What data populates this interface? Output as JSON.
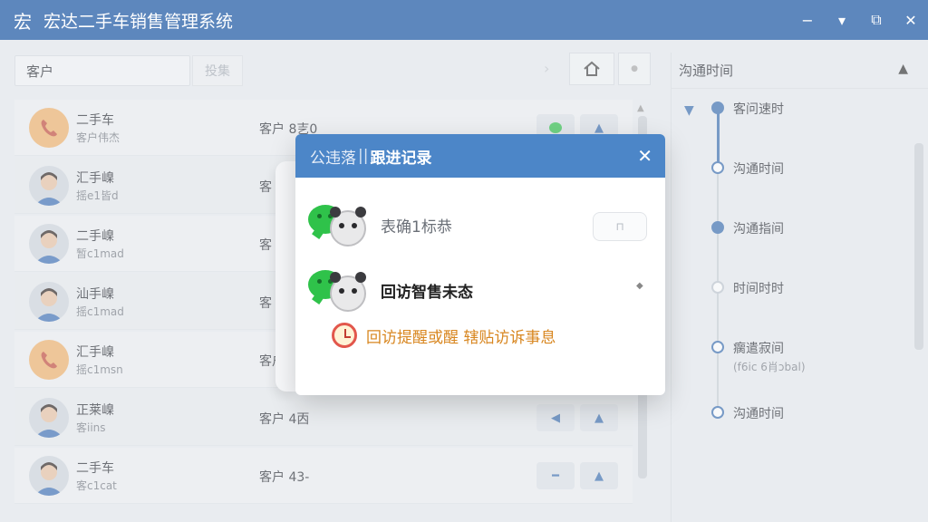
{
  "app": {
    "logo_char": "宏",
    "title": "宏达二手车销售管理系统"
  },
  "window_controls": {
    "minimize": "−",
    "menu": "▾",
    "maximize": "⧉",
    "close": "✕"
  },
  "search": {
    "value": "客户",
    "button_label": "投集"
  },
  "list": [
    {
      "name": "二手车",
      "sub": "客户伟杰",
      "customer": "客户 8㐊0",
      "avatar": "phone",
      "actions": [
        "wechat",
        "up"
      ]
    },
    {
      "name": "汇手嵲",
      "sub": "摇e1皆d",
      "customer": "客",
      "avatar": "person"
    },
    {
      "name": "二手嵲",
      "sub": "暂c1mad",
      "customer": "客",
      "avatar": "person"
    },
    {
      "name": "汕手嵲",
      "sub": "摇c1mad",
      "customer": "客",
      "avatar": "person"
    },
    {
      "name": "汇手嵲",
      "sub": "摇c1msn",
      "customer": "客户",
      "avatar": "phone"
    },
    {
      "name": "正莱嵲",
      "sub": "客iins",
      "customer": "客户 4㐁",
      "avatar": "person",
      "actions": [
        "left",
        "up"
      ]
    },
    {
      "name": "二手车",
      "sub": "客c1cat",
      "customer": "客户 43-",
      "avatar": "person",
      "actions": [
        "minus",
        "up"
      ]
    }
  ],
  "right_panel": {
    "title": "沟通时间",
    "timeline": [
      {
        "label": "客问速时",
        "sub": ""
      },
      {
        "label": "沟通时间",
        "sub": ""
      },
      {
        "label": "沟通指间",
        "sub": ""
      },
      {
        "label": "时间时时",
        "sub": ""
      },
      {
        "label": "瘸遣寂间",
        "sub": "(f6ic 6肖ɔbal)"
      },
      {
        "label": "沟通时间",
        "sub": ""
      }
    ]
  },
  "modal": {
    "title_prefix": "公违落",
    "title_sep": "||",
    "title": "跟进记录",
    "close": "✕",
    "item1_label": "表确1标恭",
    "item1_button": "⊓",
    "item2_label": "回访智售未态",
    "reminder_label": "回访提醒或醒 辖贴访诉事息"
  },
  "colors": {
    "titlebar": "#5d87bd",
    "modal_header": "#4c86c8",
    "accent": "#3a6db0",
    "reminder": "#d8861f"
  }
}
